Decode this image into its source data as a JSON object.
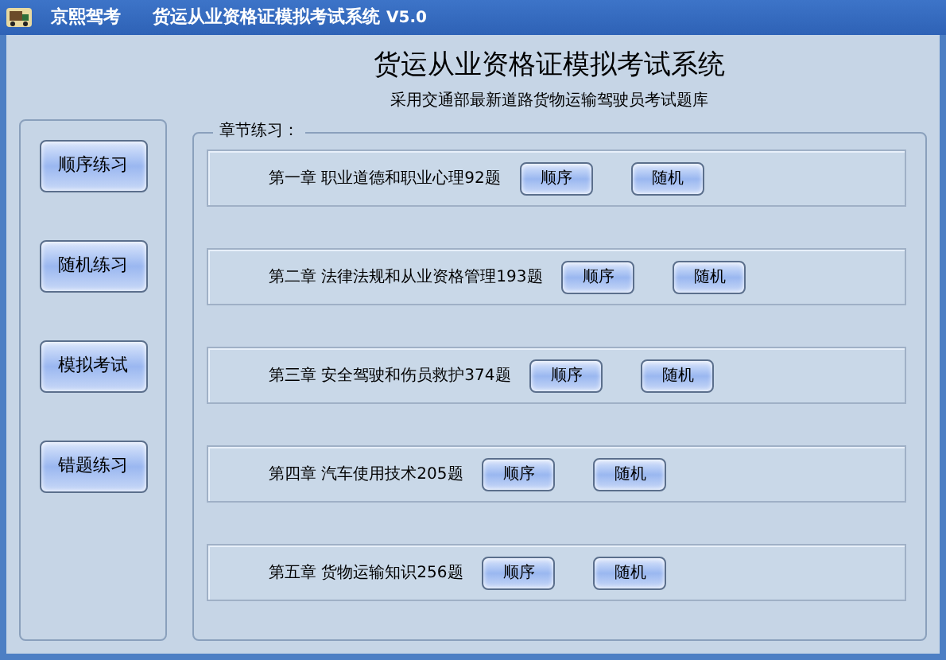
{
  "window": {
    "app_name": "京熙驾考",
    "title": "货运从业资格证模拟考试系统",
    "version": "V5.0"
  },
  "header": {
    "title": "货运从业资格证模拟考试系统",
    "subtitle": "采用交通部最新道路货物运输驾驶员考试题库"
  },
  "sidebar": {
    "buttons": [
      "顺序练习",
      "随机练习",
      "模拟考试",
      "错题练习"
    ]
  },
  "chapters": {
    "label": "章节练习：",
    "items": [
      {
        "title": "第一章 职业道德和职业心理92题",
        "buttons": [
          "顺序",
          "随机"
        ]
      },
      {
        "title": "第二章 法律法规和从业资格管理193题",
        "buttons": [
          "顺序",
          "随机"
        ]
      },
      {
        "title": "第三章 安全驾驶和伤员救护374题",
        "buttons": [
          "顺序",
          "随机"
        ]
      },
      {
        "title": "第四章 汽车使用技术205题",
        "buttons": [
          "顺序",
          "随机"
        ]
      },
      {
        "title": "第五章 货物运输知识256题",
        "buttons": [
          "顺序",
          "随机"
        ]
      }
    ]
  }
}
